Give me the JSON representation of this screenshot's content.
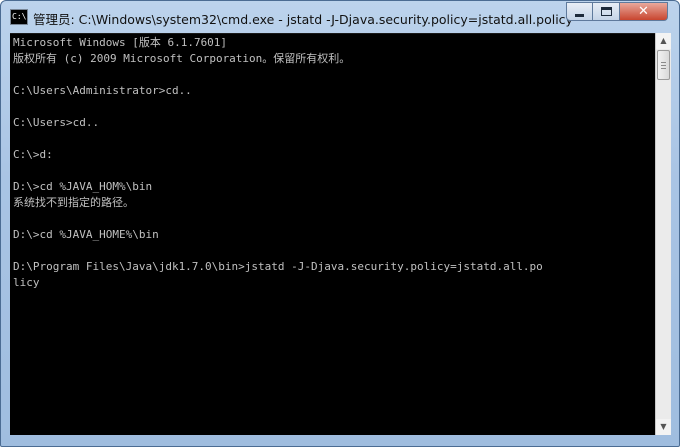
{
  "window": {
    "icon_label": "C:\\",
    "title": "管理员: C:\\Windows\\system32\\cmd.exe - jstatd  -J-Djava.security.policy=jstatd.all.policy",
    "minimize_icon": "minimize-icon",
    "maximize_icon": "maximize-icon",
    "close_icon": "close-icon",
    "close_glyph": "✕"
  },
  "console": {
    "text_color": "#c0c0c0",
    "background": "#000000",
    "lines": [
      "Microsoft Windows [版本 6.1.7601]",
      "版权所有 (c) 2009 Microsoft Corporation。保留所有权利。",
      "",
      "C:\\Users\\Administrator>cd..",
      "",
      "C:\\Users>cd..",
      "",
      "C:\\>d:",
      "",
      "D:\\>cd %JAVA_HOM%\\bin",
      "系统找不到指定的路径。",
      "",
      "D:\\>cd %JAVA_HOME%\\bin",
      "",
      "D:\\Program Files\\Java\\jdk1.7.0\\bin>jstatd -J-Djava.security.policy=jstatd.all.po",
      "licy"
    ]
  },
  "scrollbar": {
    "up_glyph": "▲",
    "down_glyph": "▼"
  }
}
